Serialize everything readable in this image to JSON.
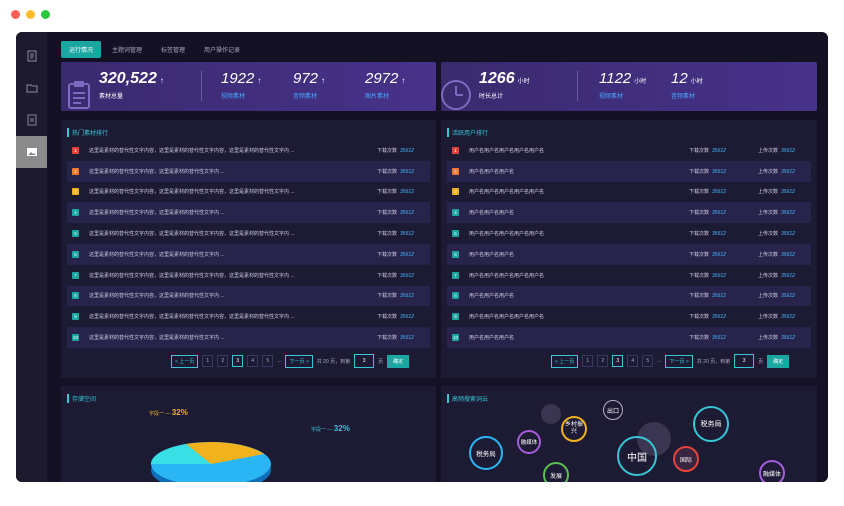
{
  "tabs": [
    "运行情况",
    "主题词管理",
    "标签管理",
    "用户操作记录"
  ],
  "stats_left": {
    "total": {
      "value": "320,522",
      "label": "素材总量",
      "arrow": "↑"
    },
    "video": {
      "value": "1922",
      "label": "视频素材",
      "arrow": "↑"
    },
    "audio": {
      "value": "972",
      "label": "音频素材",
      "arrow": "↑"
    },
    "image": {
      "value": "2972",
      "label": "图片素材",
      "arrow": "↑"
    }
  },
  "stats_right": {
    "total": {
      "value": "1266",
      "unit": "小时",
      "label": "时长总计"
    },
    "video": {
      "value": "1122",
      "unit": "小时",
      "label": "视频素材"
    },
    "audio": {
      "value": "12",
      "unit": "小时",
      "label": "音频素材"
    }
  },
  "hot_panel": {
    "title": "热门素材排行",
    "download_label": "下载次数",
    "rows": [
      {
        "rank": "1",
        "text": "这里是素材的替代性文字内容，这里是素材的替代性文字内容，这里是素材的替代性文字内 ...",
        "downloads": "35612"
      },
      {
        "rank": "2",
        "text": "这里是素材的替代性文字内容，这里是素材的替代性文字内 ...",
        "downloads": "35612"
      },
      {
        "rank": "3",
        "text": "这里是素材的替代性文字内容，这里是素材的替代性文字内容，这里是素材的替代性文字内 ...",
        "downloads": "35612"
      },
      {
        "rank": "4",
        "text": "这里是素材的替代性文字内容，这里是素材的替代性文字内 ...",
        "downloads": "35612"
      },
      {
        "rank": "5",
        "text": "这里是素材的替代性文字内容，这里是素材的替代性文字内容，这里是素材的替代性文字内 ...",
        "downloads": "35612"
      },
      {
        "rank": "6",
        "text": "这里是素材的替代性文字内容，这里是素材的替代性文字内 ...",
        "downloads": "35612"
      },
      {
        "rank": "7",
        "text": "这里是素材的替代性文字内容，这里是素材的替代性文字内容，这里是素材的替代性文字内 ...",
        "downloads": "35612"
      },
      {
        "rank": "8",
        "text": "这里是素材的替代性文字内容，这里是素材的替代性文字内 ...",
        "downloads": "35612"
      },
      {
        "rank": "9",
        "text": "这里是素材的替代性文字内容，这里是素材的替代性文字内容，这里是素材的替代性文字内 ...",
        "downloads": "35612"
      },
      {
        "rank": "10",
        "text": "这里是素材的替代性文字内容，这里是素材的替代性文字内 ...",
        "downloads": "35612"
      }
    ]
  },
  "user_panel": {
    "title": "活跃用户排行",
    "download_label": "下载次数",
    "upload_label": "上传次数",
    "rows": [
      {
        "rank": "1",
        "name": "用户名用户名用户名用户名用户名",
        "downloads": "35612",
        "uploads": "35612"
      },
      {
        "rank": "2",
        "name": "用户名用户名用户名",
        "downloads": "35612",
        "uploads": "35612"
      },
      {
        "rank": "3",
        "name": "用户名用户名用户名用户名用户名",
        "downloads": "35612",
        "uploads": "35612"
      },
      {
        "rank": "4",
        "name": "用户名用户名用户名",
        "downloads": "35612",
        "uploads": "35612"
      },
      {
        "rank": "5",
        "name": "用户名用户名用户名用户名用户名",
        "downloads": "35612",
        "uploads": "35612"
      },
      {
        "rank": "6",
        "name": "用户名用户名用户名",
        "downloads": "35612",
        "uploads": "35612"
      },
      {
        "rank": "7",
        "name": "用户名用户名用户名用户名用户名",
        "downloads": "35612",
        "uploads": "35612"
      },
      {
        "rank": "8",
        "name": "用户名用户名用户名",
        "downloads": "35612",
        "uploads": "35612"
      },
      {
        "rank": "9",
        "name": "用户名用户名用户名用户名用户名",
        "downloads": "35612",
        "uploads": "35612"
      },
      {
        "rank": "10",
        "name": "用户名用户名用户名",
        "downloads": "35612",
        "uploads": "35612"
      }
    ]
  },
  "pager": {
    "prev": "< 上一页",
    "pages": [
      "1",
      "2",
      "3",
      "4",
      "5"
    ],
    "current": "3",
    "ellipsis": "...",
    "next": "下一页 >",
    "total": "共 20 页，到第",
    "goto_value": "3",
    "page_unit": "页",
    "ok": "确定"
  },
  "storage_panel": {
    "title": "存储空间",
    "label_a": "字段一",
    "value_a": "32%",
    "label_b": "字段一",
    "value_b": "32%"
  },
  "search_panel": {
    "title": "高频搜索词云",
    "words": [
      "出口",
      "税务局",
      "乡村振兴",
      "融媒体",
      "税务局",
      "中国",
      "国际",
      "融媒体",
      "发展"
    ]
  },
  "colors": {
    "rank": [
      "#e8433b",
      "#f07b2d",
      "#f2b21e",
      "#1aa7a1",
      "#1aa7a1",
      "#1aa7a1",
      "#1aa7a1",
      "#1aa7a1",
      "#1aa7a1",
      "#1aa7a1"
    ],
    "accent": "#1aa7a1"
  }
}
